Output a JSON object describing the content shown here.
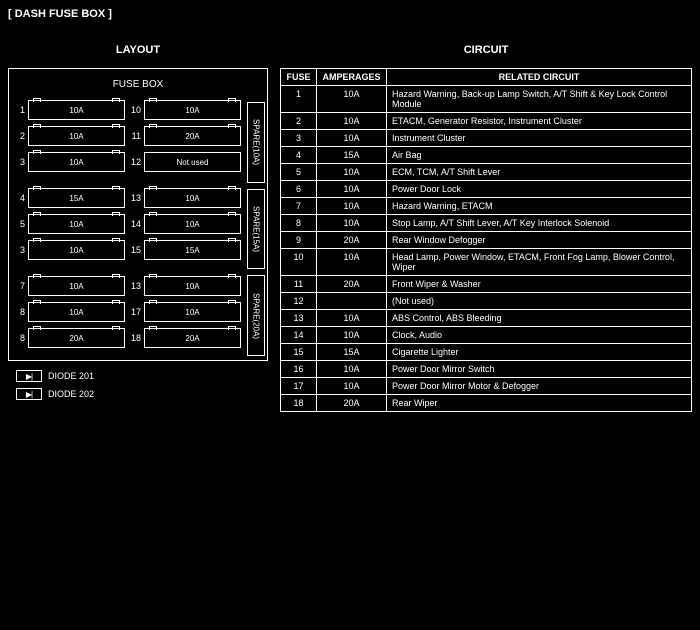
{
  "title": "[ DASH FUSE BOX ]",
  "layout_header": "LAYOUT",
  "circuit_header": "CIRCUIT",
  "fusebox_label": "FUSE BOX",
  "fuse_layout_left": [
    {
      "n": "1",
      "a": "10A"
    },
    {
      "n": "2",
      "a": "10A"
    },
    {
      "n": "3",
      "a": "10A"
    },
    {
      "n": "4",
      "a": "15A"
    },
    {
      "n": "5",
      "a": "10A"
    },
    {
      "n": "3",
      "a": "10A"
    },
    {
      "n": "7",
      "a": "10A"
    },
    {
      "n": "8",
      "a": "10A"
    },
    {
      "n": "8",
      "a": "20A"
    }
  ],
  "fuse_layout_right": [
    {
      "n": "10",
      "a": "10A"
    },
    {
      "n": "11",
      "a": "20A"
    },
    {
      "n": "12",
      "a": "Not used",
      "nu": true
    },
    {
      "n": "13",
      "a": "10A"
    },
    {
      "n": "14",
      "a": "10A"
    },
    {
      "n": "15",
      "a": "15A"
    },
    {
      "n": "13",
      "a": "10A"
    },
    {
      "n": "17",
      "a": "10A"
    },
    {
      "n": "18",
      "a": "20A"
    }
  ],
  "spares": [
    "SPARE(10A)",
    "SPARE(15A)",
    "SPARE(20A)"
  ],
  "diodes": [
    "DIODE 201",
    "DIODE 202"
  ],
  "circuit_cols": [
    "FUSE",
    "AMPERAGES",
    "RELATED CIRCUIT"
  ],
  "circuit_rows": [
    {
      "f": "1",
      "a": "10A",
      "c": "Hazard Warning, Back-up Lamp Switch, A/T Shift & Key Lock Control Module"
    },
    {
      "f": "2",
      "a": "10A",
      "c": "ETACM, Generator Resistor, Instrument Cluster"
    },
    {
      "f": "3",
      "a": "10A",
      "c": "Instrument Cluster"
    },
    {
      "f": "4",
      "a": "15A",
      "c": "Air Bag"
    },
    {
      "f": "5",
      "a": "10A",
      "c": "ECM, TCM, A/T Shift Lever"
    },
    {
      "f": "6",
      "a": "10A",
      "c": "Power Door Lock"
    },
    {
      "f": "7",
      "a": "10A",
      "c": "Hazard Warning, ETACM"
    },
    {
      "f": "8",
      "a": "10A",
      "c": "Stop Lamp, A/T Shift Lever, A/T Key Interlock Solenoid"
    },
    {
      "f": "9",
      "a": "20A",
      "c": "Rear Window Defogger"
    },
    {
      "f": "10",
      "a": "10A",
      "c": "Head Lamp, Power Window, ETACM, Front Fog Lamp, Blower Control, Wiper"
    },
    {
      "f": "11",
      "a": "20A",
      "c": "Front Wiper & Washer"
    },
    {
      "f": "12",
      "a": "",
      "c": "(Not used)"
    },
    {
      "f": "13",
      "a": "10A",
      "c": "ABS Control, ABS Bleeding"
    },
    {
      "f": "14",
      "a": "10A",
      "c": "Clock, Audio"
    },
    {
      "f": "15",
      "a": "15A",
      "c": "Cigarette Lighter"
    },
    {
      "f": "16",
      "a": "10A",
      "c": "Power Door Mirror Switch"
    },
    {
      "f": "17",
      "a": "10A",
      "c": "Power Door Mirror Motor & Defogger"
    },
    {
      "f": "18",
      "a": "20A",
      "c": "Rear Wiper"
    }
  ]
}
